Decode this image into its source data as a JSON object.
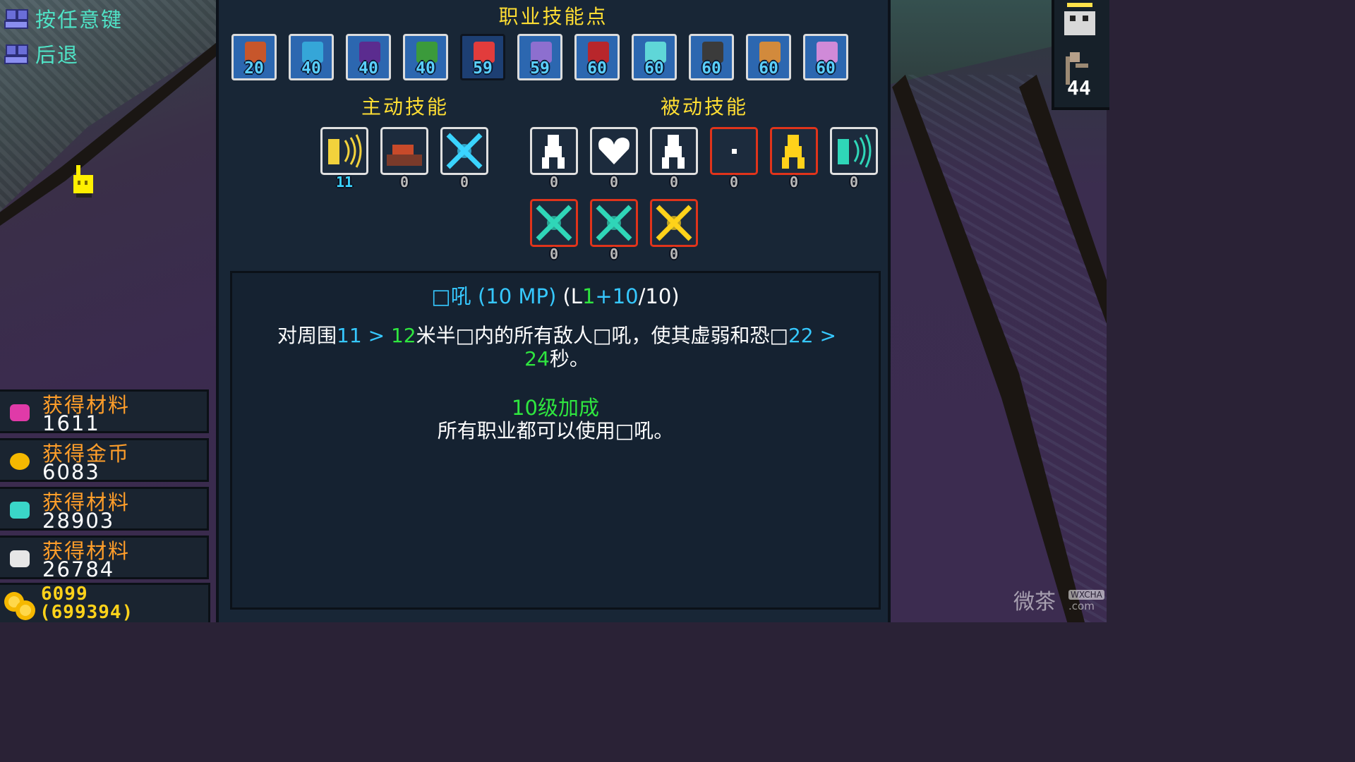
{
  "hints": {
    "any_key": "按任意键",
    "back": "后退"
  },
  "top_right": {
    "level": "44"
  },
  "panel": {
    "title": "职业技能点",
    "classes": [
      {
        "name": "warrior",
        "level": "20",
        "color": "#c7562b",
        "selected": false
      },
      {
        "name": "knight",
        "level": "40",
        "color": "#35a6d8",
        "selected": false
      },
      {
        "name": "mage",
        "level": "40",
        "color": "#5b2c8f",
        "selected": false
      },
      {
        "name": "ranger",
        "level": "40",
        "color": "#3b9a3b",
        "selected": false
      },
      {
        "name": "jester",
        "level": "59",
        "color": "#e23c3c",
        "selected": true
      },
      {
        "name": "priest",
        "level": "59",
        "color": "#8d6fcf",
        "selected": false
      },
      {
        "name": "ninja",
        "level": "60",
        "color": "#b8262b",
        "selected": false
      },
      {
        "name": "spirit",
        "level": "60",
        "color": "#5fd6d8",
        "selected": false
      },
      {
        "name": "monk",
        "level": "60",
        "color": "#3b3b3b",
        "selected": false
      },
      {
        "name": "druid",
        "level": "60",
        "color": "#d28a3c",
        "selected": false
      },
      {
        "name": "octopus",
        "level": "60",
        "color": "#d08ad8",
        "selected": false
      }
    ],
    "active_title": "主动技能",
    "passive_title": "被动技能",
    "active_skills": [
      {
        "name": "shout",
        "level": "11",
        "highlight": true,
        "red": false
      },
      {
        "name": "campfire",
        "level": "0",
        "highlight": false,
        "red": false
      },
      {
        "name": "blast",
        "level": "0",
        "highlight": false,
        "red": false
      }
    ],
    "passive_skills": [
      {
        "name": "runner",
        "level": "0",
        "red": false
      },
      {
        "name": "heart",
        "level": "0",
        "red": false
      },
      {
        "name": "strength",
        "level": "0",
        "red": false
      },
      {
        "name": "dot",
        "level": "0",
        "red": true
      },
      {
        "name": "golden-figure",
        "level": "0",
        "red": true
      },
      {
        "name": "echo",
        "level": "0",
        "red": false
      }
    ],
    "extra_skills": [
      {
        "name": "ground-burst",
        "level": "0",
        "red": true
      },
      {
        "name": "ice-burst",
        "level": "0",
        "red": true
      },
      {
        "name": "gold-burst",
        "level": "0",
        "red": true
      }
    ]
  },
  "description": {
    "title_name": "□吼",
    "title_mp": "(10 MP)",
    "title_level_prefix": "(L",
    "title_level_base": "1",
    "title_level_plus": "+10",
    "title_level_max": "/10)",
    "body_pre": "对周围",
    "body_range": "11 > 12",
    "body_mid": "米半□内的所有敌人□吼，使其虚弱和恐□",
    "body_dur_a": "22 >",
    "body_dur_b": "24",
    "body_post": "秒。",
    "bonus_title": "10级加成",
    "bonus_text": "所有职业都可以使用□吼。"
  },
  "loot": [
    {
      "label": "获得材料",
      "value": "1611",
      "icon": "rainbow-material-icon"
    },
    {
      "label": "获得金币",
      "value": "6083",
      "icon": "gold-coin-icon"
    },
    {
      "label": "获得材料",
      "value": "28903",
      "icon": "cyan-gem-icon"
    },
    {
      "label": "获得材料",
      "value": "26784",
      "icon": "white-stone-icon"
    }
  ],
  "gold_total": {
    "current": "6099",
    "total": "(699394)"
  },
  "watermark": {
    "text": "微茶",
    "badge": "WXCHA",
    "domain": ".com"
  }
}
